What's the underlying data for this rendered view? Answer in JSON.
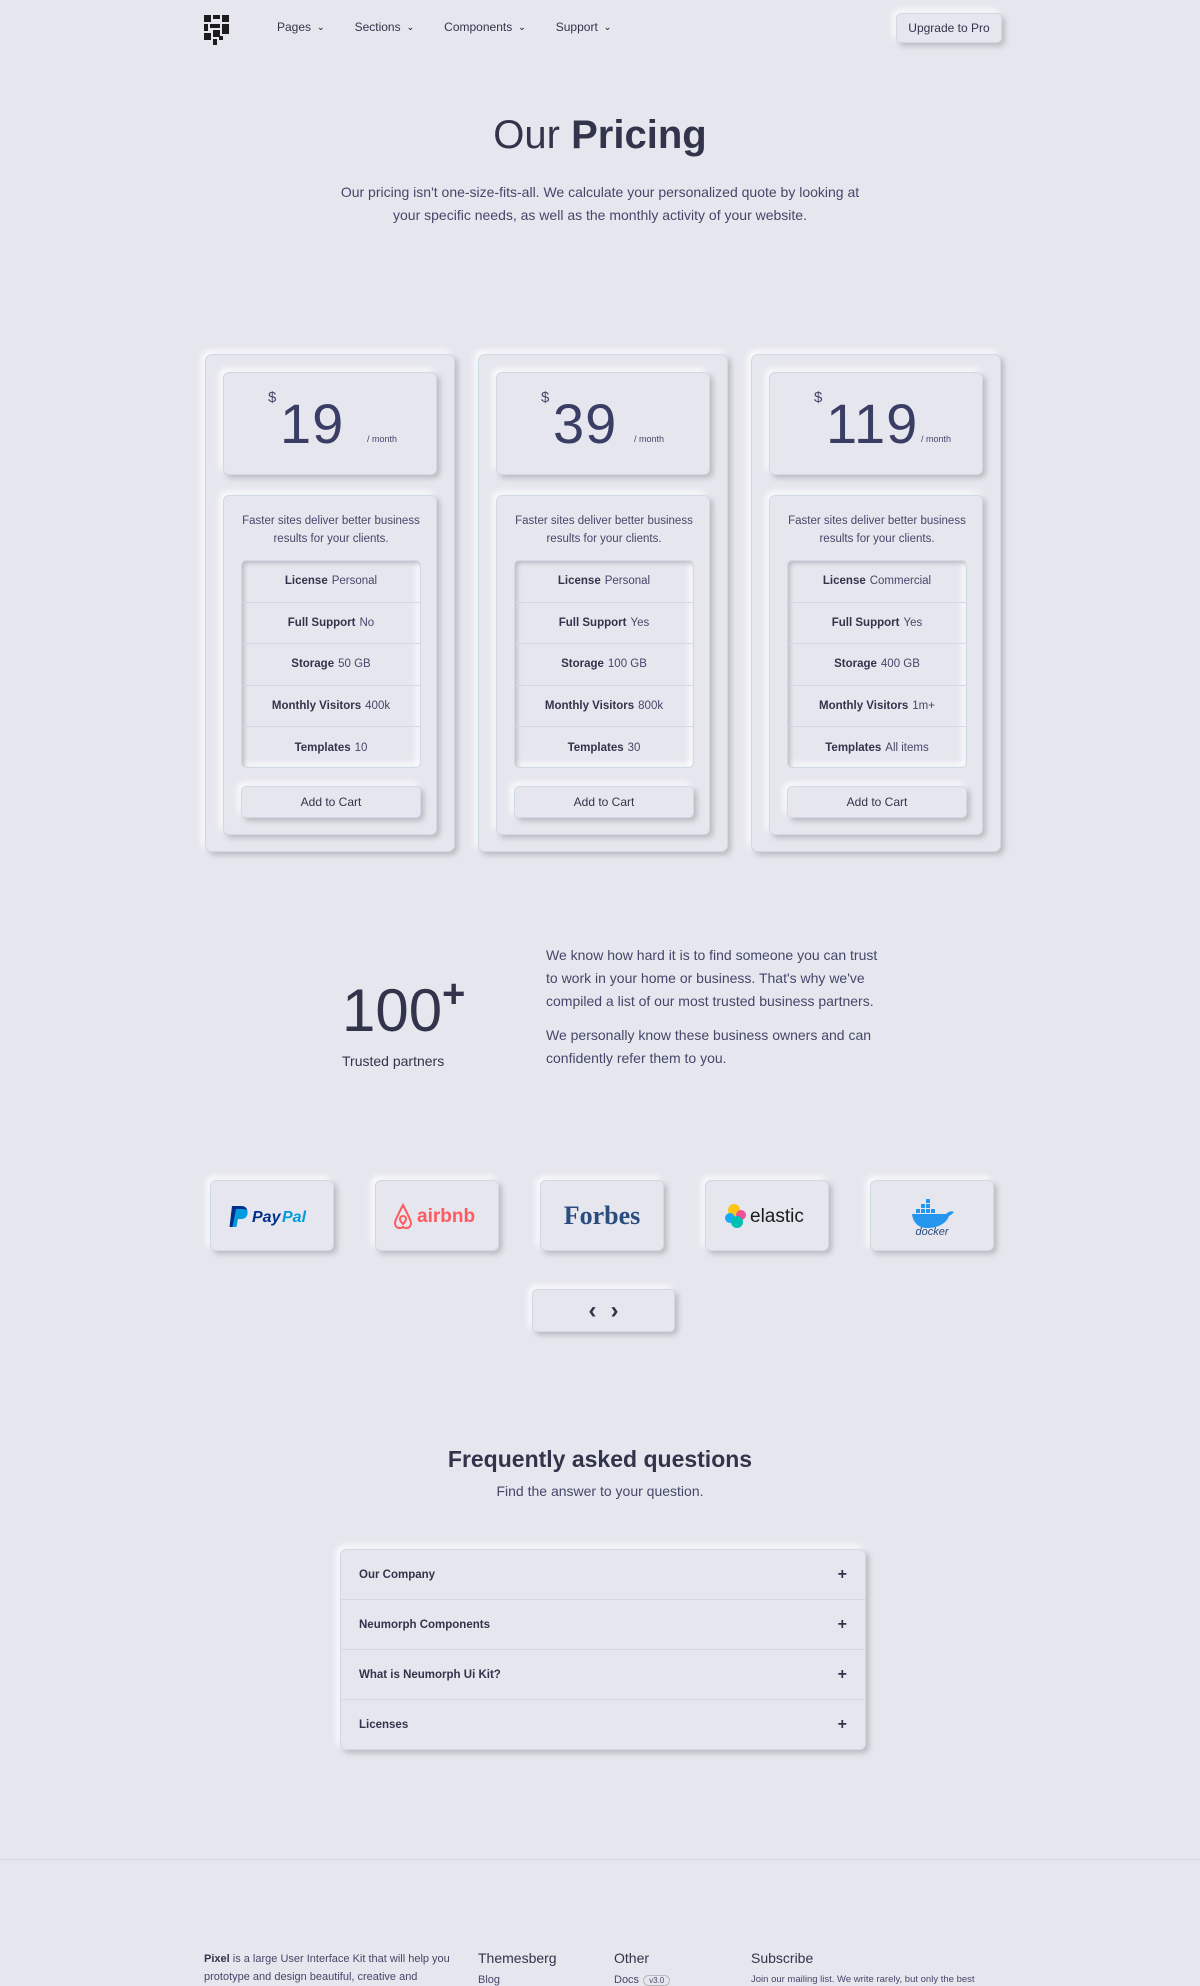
{
  "nav": {
    "logo": "logo-icon",
    "items": [
      {
        "label": "Pages"
      },
      {
        "label": "Sections"
      },
      {
        "label": "Components"
      },
      {
        "label": "Support"
      }
    ],
    "cta": "Upgrade to Pro"
  },
  "hero": {
    "title_light": "Our",
    "title_bold": "Pricing",
    "text": "Our pricing isn't one-size-fits-all. We calculate your personalized quote by looking at your specific needs, as well as the monthly activity of your website."
  },
  "plans": [
    {
      "currency": "$",
      "price": "19",
      "period": "/ month",
      "desc": "Faster sites deliver better business results for your clients.",
      "features": [
        {
          "key": "License",
          "val": "Personal"
        },
        {
          "key": "Full Support",
          "val": "No"
        },
        {
          "key": "Storage",
          "val": "50 GB"
        },
        {
          "key": "Monthly Visitors",
          "val": "400k"
        },
        {
          "key": "Templates",
          "val": "10"
        }
      ],
      "button": "Add to Cart"
    },
    {
      "currency": "$",
      "price": "39",
      "period": "/ month",
      "desc": "Faster sites deliver better business results for your clients.",
      "features": [
        {
          "key": "License",
          "val": "Personal"
        },
        {
          "key": "Full Support",
          "val": "Yes"
        },
        {
          "key": "Storage",
          "val": "100 GB"
        },
        {
          "key": "Monthly Visitors",
          "val": "800k"
        },
        {
          "key": "Templates",
          "val": "30"
        }
      ],
      "button": "Add to Cart"
    },
    {
      "currency": "$",
      "price": "119",
      "period": "/ month",
      "desc": "Faster sites deliver better business results for your clients.",
      "features": [
        {
          "key": "License",
          "val": "Commercial"
        },
        {
          "key": "Full Support",
          "val": "Yes"
        },
        {
          "key": "Storage",
          "val": "400 GB"
        },
        {
          "key": "Monthly Visitors",
          "val": "1m+"
        },
        {
          "key": "Templates",
          "val": "All items"
        }
      ],
      "button": "Add to Cart"
    }
  ],
  "partners": {
    "number": "100",
    "plus": "+",
    "label": "Trusted partners",
    "p1": "We know how hard it is to find someone you can trust to work in your home or business. That's why we've compiled a list of our most trusted business partners.",
    "p2": "We personally know these business owners and can confidently refer them to you.",
    "logos": [
      "PayPal",
      "airbnb",
      "Forbes",
      "elastic",
      "docker"
    ],
    "colors": {
      "paypal_dark": "#003087",
      "paypal_light": "#009cde",
      "airbnb": "#ff5a5f",
      "forbes": "#2b4c7e",
      "docker": "#2496ed"
    }
  },
  "faq": {
    "title_light": "Frequently asked",
    "title_bold": "questions",
    "subtitle": "Find the answer to your question.",
    "items": [
      "Our Company",
      "Neumorph Components",
      "What is Neumorph Ui Kit?",
      "Licenses"
    ]
  },
  "footer": {
    "brand": "Pixel",
    "about": "is a large User Interface Kit that will help you prototype and design beautiful, creative and",
    "col1_title": "Themesberg",
    "col1_link": "Blog",
    "col2_title": "Other",
    "col2_link": "Docs",
    "col2_badge": "v3.0",
    "col3_title": "Subscribe",
    "col3_text": "Join our mailing list. We write rarely, but only the best"
  }
}
